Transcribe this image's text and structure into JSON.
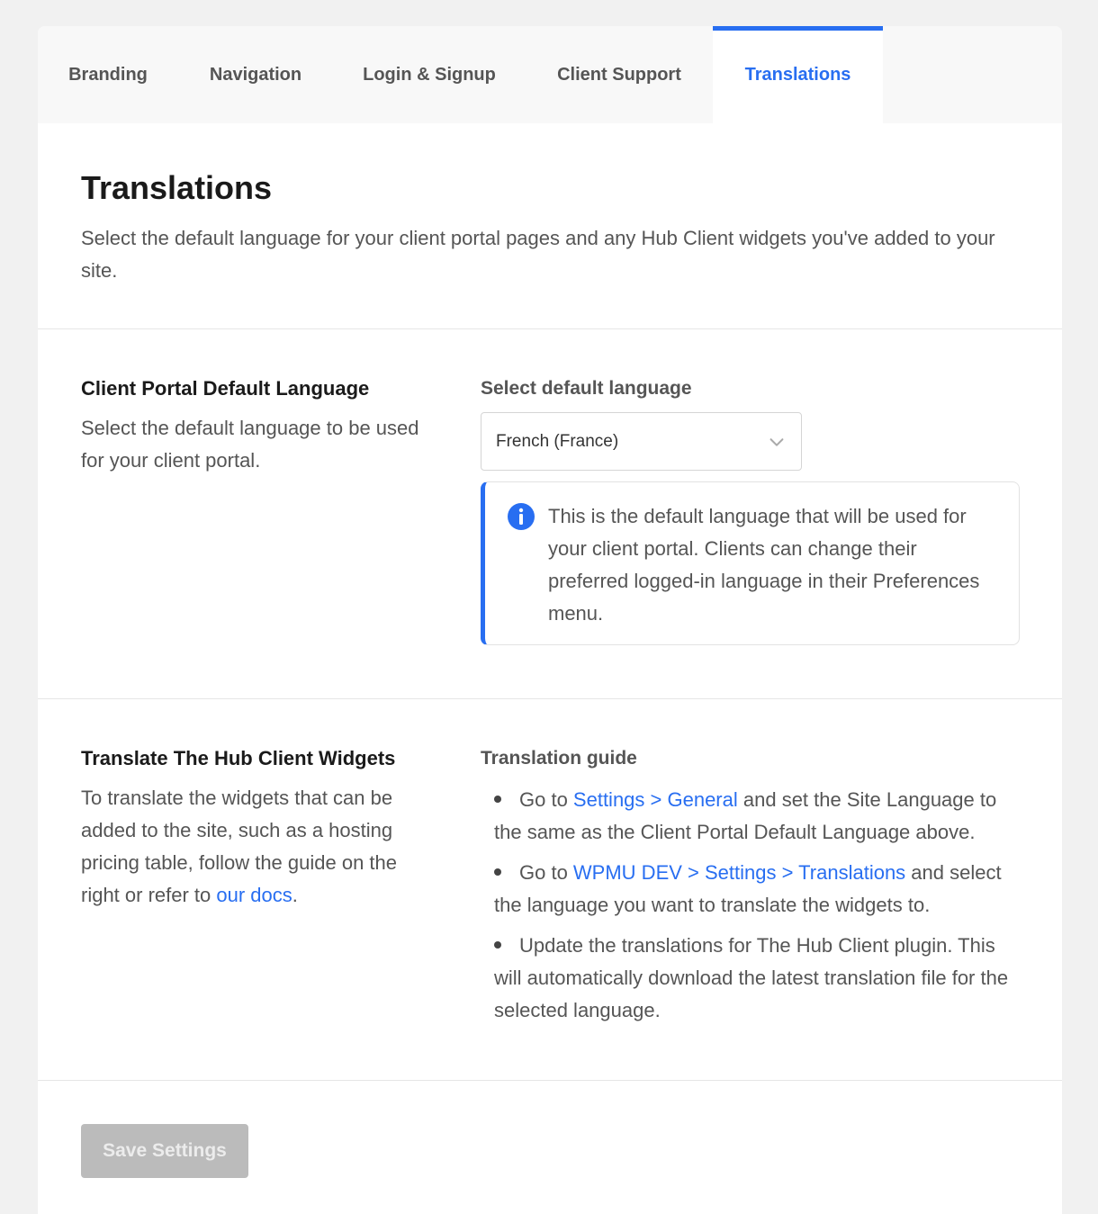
{
  "tabs": [
    {
      "label": "Branding"
    },
    {
      "label": "Navigation"
    },
    {
      "label": "Login & Signup"
    },
    {
      "label": "Client Support"
    },
    {
      "label": "Translations",
      "active": true
    }
  ],
  "header": {
    "title": "Translations",
    "description": "Select the default language for your client portal pages and any Hub Client widgets you've added to your site."
  },
  "default_language": {
    "title": "Client Portal Default Language",
    "description": "Select the default language to be used for your client portal.",
    "field_label": "Select default language",
    "selected_value": "French (France)",
    "notice": "This is the default language that will be used for your client portal. Clients can change their preferred logged-in language in their Preferences menu."
  },
  "widgets": {
    "title": "Translate The Hub Client Widgets",
    "description_prefix": "To translate the widgets that can be added to the site, such as a hosting pricing table, follow the guide on the right or refer to ",
    "docs_link": "our docs",
    "description_suffix": ".",
    "guide_title": "Translation guide",
    "guide": {
      "item1_prefix": "Go to ",
      "item1_link": "Settings > General",
      "item1_suffix": " and set the Site Language to the same as the Client Portal Default Language above.",
      "item2_prefix": "Go to ",
      "item2_link": "WPMU DEV > Settings > Translations",
      "item2_suffix": " and select the language you want to translate the widgets to.",
      "item3": "Update the translations for The Hub Client plugin. This will automatically download the latest translation file for the selected language."
    }
  },
  "footer": {
    "save_label": "Save Settings"
  },
  "colors": {
    "accent": "#286ef1",
    "disabled_button": "#bbbbbb"
  }
}
